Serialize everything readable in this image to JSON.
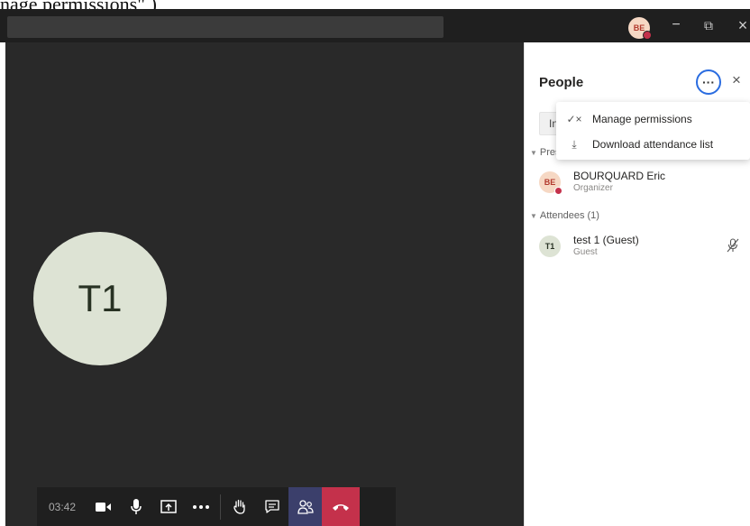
{
  "caption": {
    "text": "nage permissions\" )"
  },
  "titlebar": {
    "avatar_initials": "BE",
    "minimize_glyph": "−",
    "maximize_glyph": "⧉",
    "close_glyph": "×"
  },
  "stage": {
    "participant_initials": "T1"
  },
  "controls": {
    "timer": "03:42",
    "accent_color": "#3b3f6b",
    "hangup_color": "#c4314b"
  },
  "people_panel": {
    "title": "People",
    "more_glyph": "···",
    "close_glyph": "×",
    "invite_label": "In",
    "presenters": {
      "header": "Pres",
      "people": [
        {
          "initials": "BE",
          "name": "BOURQUARD Eric",
          "role": "Organizer"
        }
      ]
    },
    "attendees": {
      "header": "Attendees (1)",
      "people": [
        {
          "initials": "T1",
          "name": "test 1 (Guest)",
          "role": "Guest"
        }
      ]
    }
  },
  "more_menu": {
    "items": [
      {
        "icon": "manage-permissions-icon",
        "glyph": "✓×",
        "label": "Manage permissions"
      },
      {
        "icon": "download-icon",
        "glyph": "⤓",
        "label": "Download attendance list"
      }
    ]
  }
}
